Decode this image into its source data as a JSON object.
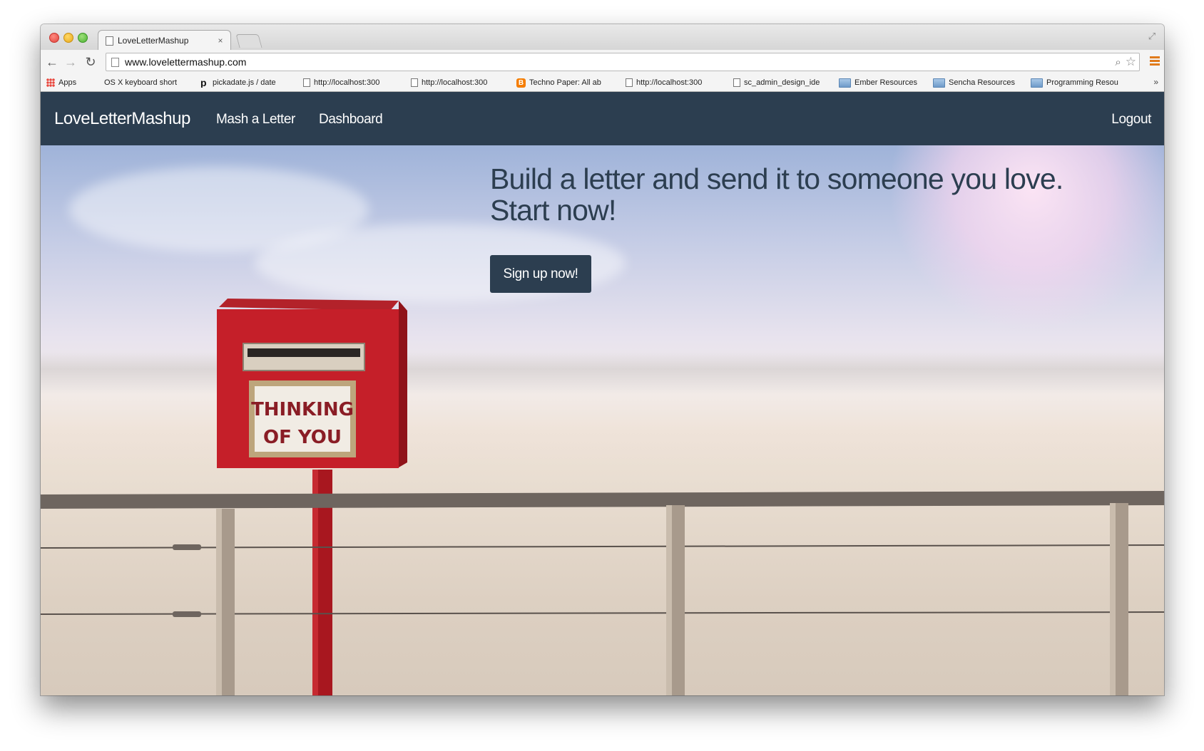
{
  "browser": {
    "tab_title": "LoveLetterMashup",
    "tab_close": "×",
    "url": "www.lovelettermashup.com",
    "bookmarks": [
      {
        "label": "Apps",
        "icon": "apps-grid-icon"
      },
      {
        "label": "OS X keyboard short",
        "icon": "apple-icon"
      },
      {
        "label": "pickadate.js / date",
        "icon": "pickadate-icon"
      },
      {
        "label": "http://localhost:300",
        "icon": "document-icon"
      },
      {
        "label": "http://localhost:300",
        "icon": "document-icon"
      },
      {
        "label": "Techno Paper: All ab",
        "icon": "blogger-icon"
      },
      {
        "label": "http://localhost:300",
        "icon": "document-icon"
      },
      {
        "label": "sc_admin_design_ide",
        "icon": "document-icon"
      },
      {
        "label": "Ember Resources",
        "icon": "folder-icon"
      },
      {
        "label": "Sencha Resources",
        "icon": "folder-icon"
      },
      {
        "label": "Programming Resou",
        "icon": "folder-icon"
      }
    ],
    "bookmarks_more": "»"
  },
  "navbar": {
    "brand": "LoveLetterMashup",
    "links": [
      "Mash a Letter",
      "Dashboard"
    ],
    "logout": "Logout",
    "background": "#2c3e50"
  },
  "hero": {
    "headline": "Build a letter and send it to someone you love. Start now!",
    "cta": "Sign up now!",
    "mailbox_sign_line1": "THINKING",
    "mailbox_sign_line2": "OF YOU",
    "accent": "#2c3e50",
    "mailbox_color": "#c0202a"
  }
}
